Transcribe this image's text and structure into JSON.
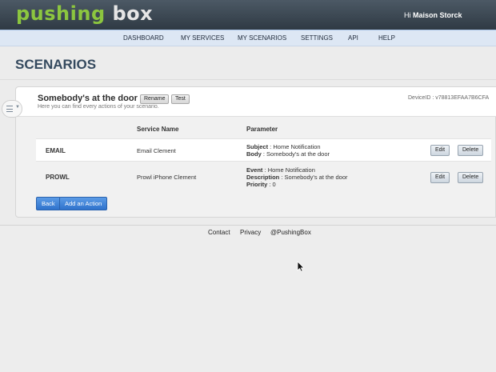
{
  "header": {
    "logo_part1": "pushing",
    "logo_part2": " box",
    "greeting_prefix": "Hi ",
    "user_name": "Maison Storck"
  },
  "nav": {
    "items": [
      {
        "label": "DASHBOARD"
      },
      {
        "label": "MY SERVICES"
      },
      {
        "label": "MY SCENARIOS"
      },
      {
        "label": "SETTINGS"
      },
      {
        "label": "API"
      },
      {
        "label": "HELP"
      }
    ]
  },
  "page": {
    "title": "SCENARIOS"
  },
  "scenario": {
    "title": "Somebody's at the door",
    "rename_label": "Rename",
    "test_label": "Test",
    "subtitle": "Here you can find every actions of your scenario.",
    "device_id": "DeviceID : v78813EFAA7B6CFA"
  },
  "table": {
    "headers": {
      "service_name": "Service Name",
      "parameter": "Parameter"
    },
    "rows": [
      {
        "type": "EMAIL",
        "service_name": "Email Clement",
        "params": [
          {
            "key": "Subject",
            "sep": " : ",
            "value": "Home Notification"
          },
          {
            "key": "Body",
            "sep": " : ",
            "value": "Somebody's at the door"
          }
        ],
        "edit_label": "Edit",
        "delete_label": "Delete"
      },
      {
        "type": "PROWL",
        "service_name": "Prowl iPhone Clement",
        "params": [
          {
            "key": "Event",
            "sep": " : ",
            "value": "Home Notification"
          },
          {
            "key": "Description",
            "sep": " : ",
            "value": "Somebody's at the door"
          },
          {
            "key": "Priority",
            "sep": " : ",
            "value": "0"
          }
        ],
        "edit_label": "Edit",
        "delete_label": "Delete"
      }
    ]
  },
  "actions": {
    "back_label": "Back",
    "add_action_label": "Add an Action"
  },
  "footer": {
    "links": [
      {
        "label": "Contact"
      },
      {
        "label": "Privacy"
      },
      {
        "label": "@PushingBox"
      }
    ]
  },
  "icons": {
    "menu_toggle": "list-icon",
    "cursor": "mouse-pointer-icon"
  },
  "colors": {
    "brand_green": "#8cc63f",
    "header_dark": "#2f3a44",
    "nav_bg": "#dde7f4",
    "primary_button": "#2f72cc"
  }
}
